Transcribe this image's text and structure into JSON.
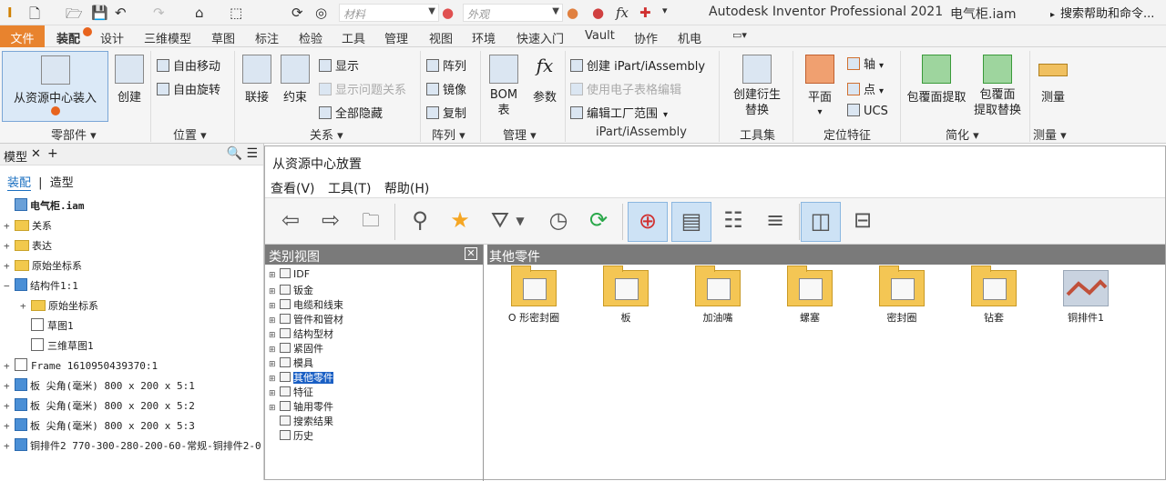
{
  "window": {
    "app_title": "Autodesk Inventor Professional 2021",
    "file_title": "电气柜.iam",
    "help_search": "搜索帮助和命令..."
  },
  "qat": {
    "material_placeholder": "材料",
    "appearance_placeholder": "外观",
    "fx": "fx"
  },
  "tabs": [
    "文件",
    "装配",
    "设计",
    "三维模型",
    "草图",
    "标注",
    "检验",
    "工具",
    "管理",
    "视图",
    "环境",
    "快速入门",
    "Vault",
    "协作",
    "机电"
  ],
  "ribbon": {
    "place_from_cc": "从资源中心装入",
    "create": "创建",
    "free_move": "自由移动",
    "free_rotate": "自由旋转",
    "join": "联接",
    "constrain": "约束",
    "show": "显示",
    "show_problem": "显示问题关系",
    "hide_all": "全部隐藏",
    "pattern": "阵列",
    "mirror": "镜像",
    "copy": "复制",
    "bom": "BOM\n表",
    "params": "参数",
    "create_ipart": "创建 iPart/iAssembly",
    "edit_table": "使用电子表格编辑",
    "edit_factory": "编辑工厂范围",
    "derive": "创建衍生\n替换",
    "plane": "平面",
    "axis": "轴",
    "point": "点",
    "ucs": "UCS",
    "shrinkwrap": "包覆面提取",
    "shrinkwrap_sub": "包覆面\n提取替换",
    "measure": "测量",
    "groups": {
      "component": "零部件 ▾",
      "position": "位置 ▾",
      "relations": "关系 ▾",
      "pattern": "阵列 ▾",
      "manage": "管理 ▾",
      "ipart": "iPart/iAssembly",
      "toolset": "工具集",
      "workfeatures": "定位特征",
      "simplify": "简化 ▾",
      "measure": "测量 ▾"
    }
  },
  "browser": {
    "tab": "模型",
    "subtab_assembly": "装配",
    "subtab_modeling": "造型",
    "tree": [
      {
        "label": "电气柜.iam",
        "level": 0,
        "exp": "",
        "icon": "asm",
        "bold": true
      },
      {
        "label": "关系",
        "level": 0,
        "exp": "+",
        "icon": "folder"
      },
      {
        "label": "表达",
        "level": 0,
        "exp": "+",
        "icon": "folder"
      },
      {
        "label": "原始坐标系",
        "level": 0,
        "exp": "+",
        "icon": "folder"
      },
      {
        "label": "结构件1:1",
        "level": 0,
        "exp": "−",
        "icon": "cube"
      },
      {
        "label": "原始坐标系",
        "level": 1,
        "exp": "+",
        "icon": "folder"
      },
      {
        "label": "草图1",
        "level": 1,
        "exp": "",
        "icon": "sketch"
      },
      {
        "label": "三维草图1",
        "level": 1,
        "exp": "",
        "icon": "sketch"
      },
      {
        "label": "Frame 1610950439370:1",
        "level": 0,
        "exp": "+",
        "icon": "frame"
      },
      {
        "label": "板 尖角(毫米) 800 x 200 x 5:1",
        "level": 0,
        "exp": "+",
        "icon": "cube"
      },
      {
        "label": "板 尖角(毫米) 800 x 200 x 5:2",
        "level": 0,
        "exp": "+",
        "icon": "cube"
      },
      {
        "label": "板 尖角(毫米) 800 x 200 x 5:3",
        "level": 0,
        "exp": "+",
        "icon": "cube"
      },
      {
        "label": "铜排件2 770-300-280-200-60-常规-铜排件2-0",
        "level": 0,
        "exp": "+",
        "icon": "part"
      }
    ]
  },
  "dialog": {
    "title": "从资源中心放置",
    "menu": [
      "查看(V)",
      "工具(T)",
      "帮助(H)"
    ],
    "cat_header": "类别视图",
    "items_header": "其他零件",
    "categories": [
      {
        "label": "IDF",
        "pm": "⊞",
        "sel": false
      },
      {
        "label": "钣金",
        "pm": "⊞",
        "sel": false
      },
      {
        "label": "电缆和线束",
        "pm": "⊞",
        "sel": false
      },
      {
        "label": "管件和管材",
        "pm": "⊞",
        "sel": false
      },
      {
        "label": "结构型材",
        "pm": "⊞",
        "sel": false
      },
      {
        "label": "紧固件",
        "pm": "⊞",
        "sel": false
      },
      {
        "label": "模具",
        "pm": "⊞",
        "sel": false
      },
      {
        "label": "其他零件",
        "pm": "⊞",
        "sel": true
      },
      {
        "label": "特征",
        "pm": "⊞",
        "sel": false
      },
      {
        "label": "轴用零件",
        "pm": "⊞",
        "sel": false
      },
      {
        "label": "搜索结果",
        "pm": "",
        "sel": false
      },
      {
        "label": "历史",
        "pm": "",
        "sel": false
      }
    ],
    "items": [
      {
        "label": "O 形密封圈",
        "type": "folder"
      },
      {
        "label": "板",
        "type": "folder"
      },
      {
        "label": "加油嘴",
        "type": "folder"
      },
      {
        "label": "螺塞",
        "type": "folder"
      },
      {
        "label": "密封圈",
        "type": "folder"
      },
      {
        "label": "钻套",
        "type": "folder"
      },
      {
        "label": "铜排件1",
        "type": "thumb"
      }
    ]
  },
  "colors": {
    "file_tab": "#e8832e",
    "selection": "#1a5fc4",
    "pane_header": "#7a7a7a"
  }
}
